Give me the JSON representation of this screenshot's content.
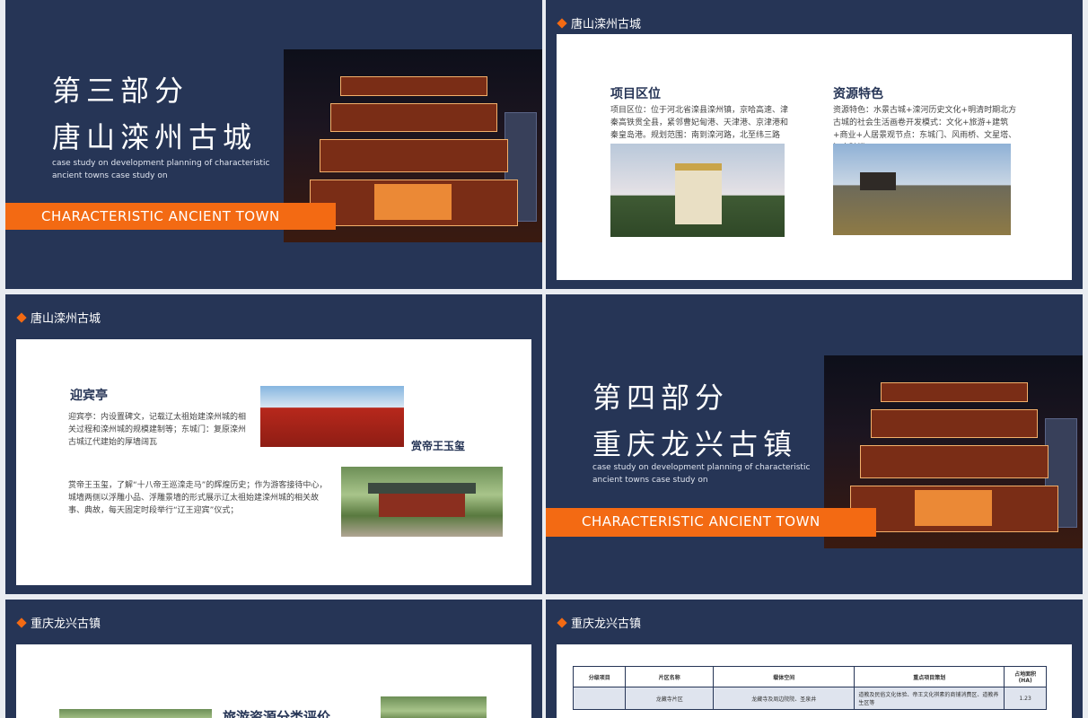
{
  "slide1": {
    "title_line1": "第三部分",
    "title_line2": "唐山滦州古城",
    "subtitle": "case study on development planning of characteristic ancient towns case study on",
    "bar_label": "CHARACTERISTIC ANCIENT TOWN"
  },
  "slide2": {
    "header": "唐山滦州古城",
    "left_heading": "项目区位",
    "left_text": "项目区位：位于河北省滦县滦州镇，京哈高速、津秦高铁贯全县，紧邻曹妃甸港、天津港、京津港和秦皇岛港。规划范围：南到滦河路，北至纬三路",
    "right_heading": "资源特色",
    "right_text": "资源特色：水景古城+滦河历史文化+明清时期北方古城的社会生活画卷开发模式：文化+旅游+建筑+商业+人居景观节点：东城门、风雨桥、文星塔、江南骑楼"
  },
  "slide3": {
    "header": "唐山滦州古城",
    "heading1": "迎宾亭",
    "text1": "迎宾亭：内设置碑文，记载辽太祖始建滦州城的相关过程和滦州城的规模建制等；东城门：复原滦州古城辽代建始的厚墙阔瓦",
    "heading2": "赏帝王玉玺",
    "text2": "赏帝王玉玺，了解“十八帝王巡滦走马”的辉煌历史；作为游客接待中心，城墙两侧以浮雕小品、浮雕景墙的形式展示辽太祖始建滦州城的相关故事、典故，每天固定时段举行“辽王迎宾”仪式；"
  },
  "slide4": {
    "title_line1": "第四部分",
    "title_line2": "重庆龙兴古镇",
    "subtitle": "case study on development planning of characteristic ancient towns case study on",
    "bar_label": "CHARACTERISTIC ANCIENT TOWN"
  },
  "slide5": {
    "header": "重庆龙兴古镇",
    "heading": "旅游资源分类评价"
  },
  "slide6": {
    "header": "重庆龙兴古镇",
    "table": {
      "headers": [
        "分级项目",
        "片区名称",
        "载体空间",
        "重点项目策划",
        "占地面积(HA)"
      ],
      "rows": [
        [
          "",
          "龙藏寺片区",
          "龙藏寺及周边院院、圣泉井",
          "道教及民俗文化体验、帝王文化祺素的商铺消费区、道教养生区等",
          "1.23"
        ]
      ]
    }
  },
  "colors": {
    "navy": "#263556",
    "orange": "#f36a13",
    "white": "#ffffff"
  }
}
